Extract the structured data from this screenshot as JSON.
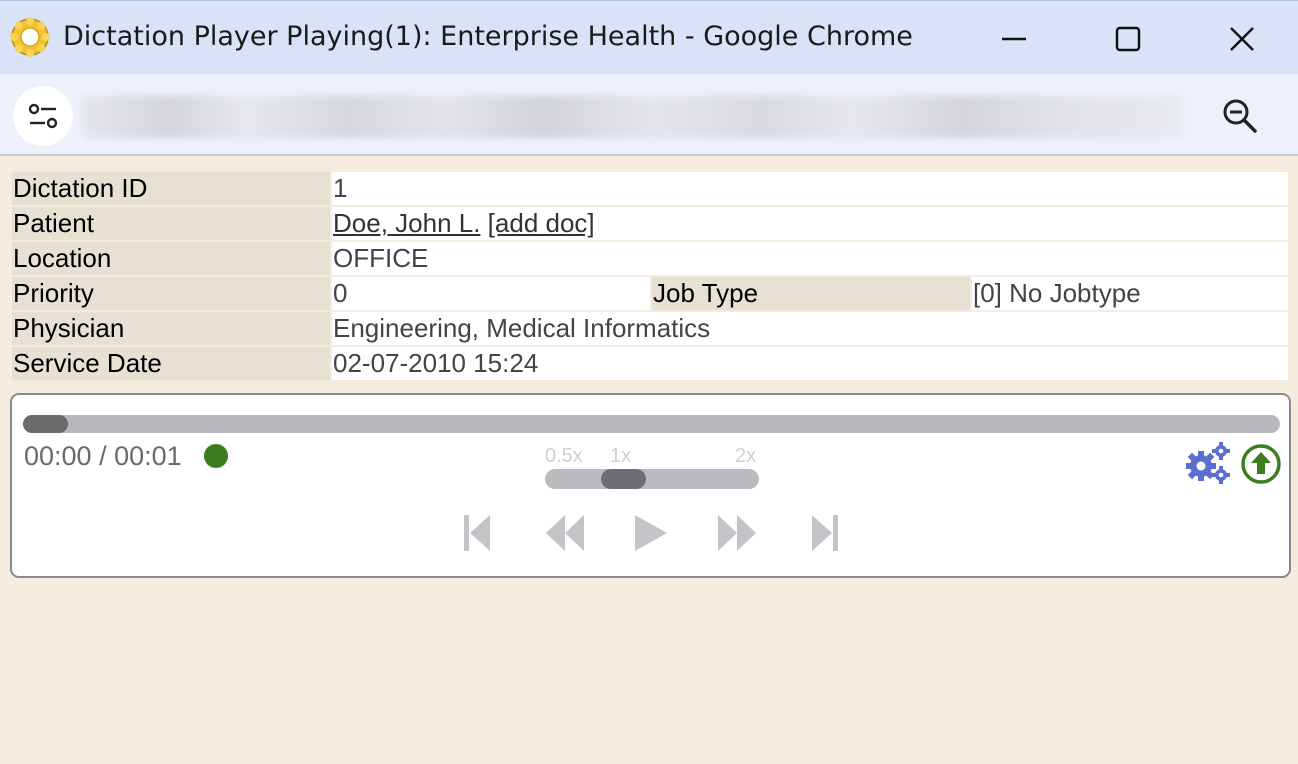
{
  "window": {
    "title": "Dictation Player Playing(1): Enterprise Health - Google Chrome",
    "icons": {
      "app": "sun-gear-icon",
      "minimize": "minimize-icon",
      "maximize": "maximize-icon",
      "close": "close-icon"
    }
  },
  "addressbar": {
    "icons": {
      "site_info": "tune-icon",
      "zoom": "zoom-out-icon"
    }
  },
  "dictation": {
    "id_label": "Dictation ID",
    "id_value": "1",
    "patient_label": "Patient",
    "patient_name": "Doe, John L.",
    "add_doc": "[add doc]",
    "location_label": "Location",
    "location_value": "OFFICE",
    "priority_label": "Priority",
    "priority_value": "0",
    "jobtype_label": "Job Type",
    "jobtype_value": "[0] No Jobtype",
    "physician_label": "Physician",
    "physician_value": "Engineering, Medical Informatics",
    "service_date_label": "Service Date",
    "service_date_value": "02-07-2010 15:24"
  },
  "player": {
    "time_display": "00:00 / 00:01",
    "progress_fraction": 0.035,
    "status_color": "#3c7d1f",
    "speed_labels": [
      "0.5x",
      "1x",
      "2x"
    ],
    "speed_value": "1x",
    "icons": {
      "settings": "gears-icon",
      "upload": "upload-circle-icon",
      "skip_start": "skip-to-start-icon",
      "rewind": "rewind-icon",
      "play": "play-icon",
      "fast_forward": "fast-forward-icon",
      "skip_end": "skip-to-end-icon"
    }
  },
  "colors": {
    "page_bg": "#f4ecdf",
    "label_bg": "#e6e1d3",
    "titlebar_bg": "#d9e2f6",
    "control_icon": "#c4c4c8",
    "gear_blue": "#5b6fd0",
    "upload_green": "#3c7d1f"
  }
}
